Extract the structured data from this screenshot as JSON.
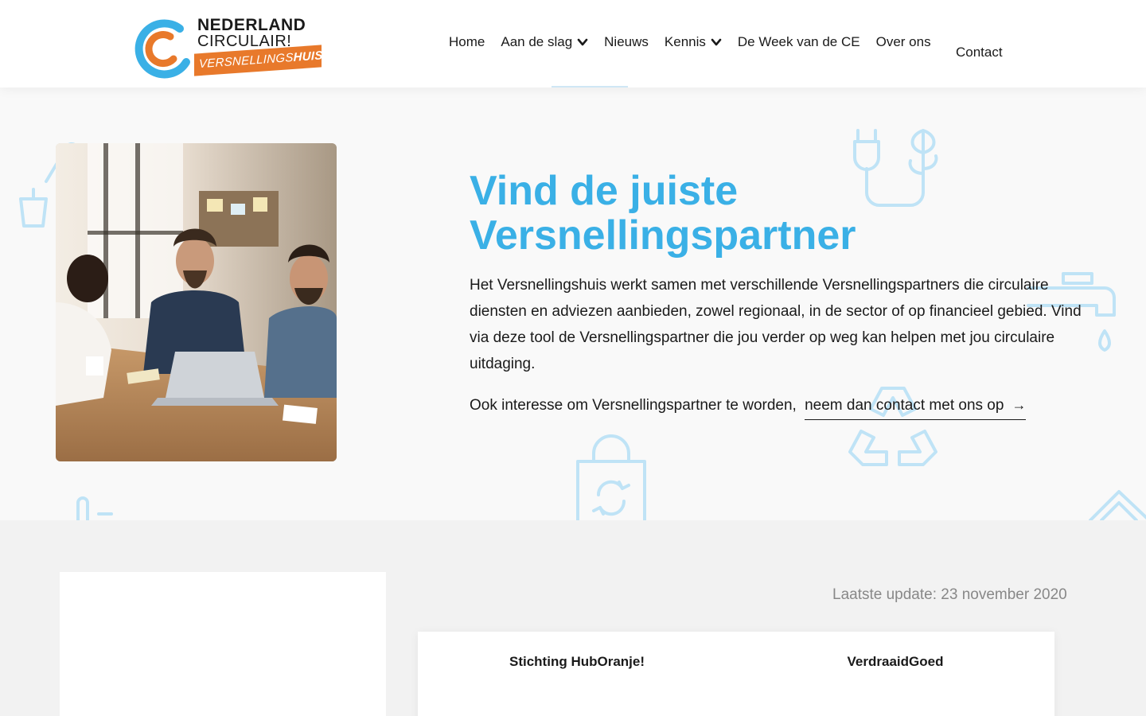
{
  "header": {
    "logo": {
      "line1": "NEDERLAND",
      "line2": "CIRCULAIR!",
      "badge_regular": "VERSNELLINGS",
      "badge_bold": "HUIS",
      "colors": {
        "blue": "#3ab0e6",
        "orange": "#e8792b"
      }
    },
    "nav": [
      {
        "label": "Home",
        "has_dropdown": false
      },
      {
        "label": "Aan de slag",
        "has_dropdown": true
      },
      {
        "label": "Nieuws",
        "has_dropdown": false
      },
      {
        "label": "Kennis",
        "has_dropdown": true
      },
      {
        "label": "De Week van de CE",
        "has_dropdown": false
      },
      {
        "label": "Over ons",
        "has_dropdown": false
      }
    ],
    "contact_label": "Contact"
  },
  "hero": {
    "title": "Vind de juiste Versnellingspartner",
    "description": "Het Versnellingshuis werkt samen met verschillende Versnellingspartners die circulaire diensten en adviezen aanbieden, zowel regionaal, in de sector of op financieel gebied. Vind via deze tool de Versnellingspartner die jou verder op weg kan helpen met jou circulaire uitdaging.",
    "cta_prefix": "Ook interesse om Versnellingspartner te worden,",
    "cta_link": "neem dan contact met ons op",
    "cta_icon": "arrow-right-icon",
    "title_color": "#3ab0e6"
  },
  "content": {
    "last_update": "Laatste update: 23 november 2020",
    "results": [
      {
        "name": "Stichting HubOranje!"
      },
      {
        "name": "VerdraaidGoed"
      }
    ]
  }
}
